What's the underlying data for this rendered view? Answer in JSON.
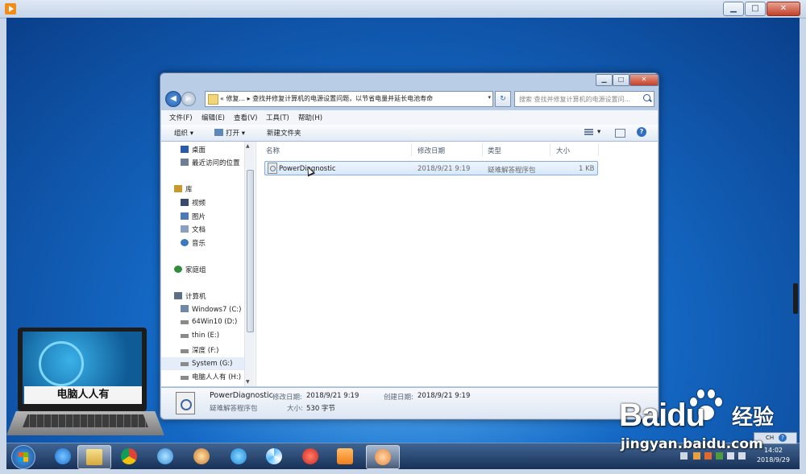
{
  "window": {
    "controls": {
      "minimize": "▁",
      "maximize": "□",
      "close": "✕"
    }
  },
  "explorer": {
    "address": {
      "path": "«  修复...  ▸ 查找并修复计算机的电源设置问题，以节省电量并延长电池寿命",
      "dropdown": "▾"
    },
    "search_placeholder": "搜索 查找并修复计算机的电源设置问...",
    "menu": [
      "文件(F)",
      "编辑(E)",
      "查看(V)",
      "工具(T)",
      "帮助(H)"
    ],
    "toolbar": {
      "organize": "组织 ▾",
      "open": "打开 ▾",
      "new_folder": "新建文件夹",
      "view_menu": "▾",
      "help": "?"
    },
    "nav": [
      {
        "label": "桌面",
        "color": "#2b5aa8"
      },
      {
        "label": "最近访问的位置",
        "color": "#6d7e95"
      },
      {
        "label": "库",
        "color": "#c79a2b"
      },
      {
        "label": "视频",
        "color": "#3b4a6a"
      },
      {
        "label": "图片",
        "color": "#4a7bb8"
      },
      {
        "label": "文档",
        "color": "#8aa0bf"
      },
      {
        "label": "音乐",
        "color": "#3a78c0"
      },
      {
        "label": "家庭组",
        "color": "#2f8e3a"
      },
      {
        "label": "计算机",
        "color": "#5d6f87"
      },
      {
        "label": "Windows7 (C:)",
        "color": "#6f8aa8"
      },
      {
        "label": "64Win10 (D:)",
        "color": "#8a8a8a"
      },
      {
        "label": "thin (E:)",
        "color": "#8a8a8a"
      },
      {
        "label": "深度 (F:)",
        "color": "#8a8a8a"
      },
      {
        "label": "System (G:)",
        "color": "#8a8a8a"
      },
      {
        "label": "电脑人人有 (H:)",
        "color": "#8a8a8a"
      }
    ],
    "columns": {
      "name": "名称",
      "modified": "修改日期",
      "type": "类型",
      "size": "大小"
    },
    "files": [
      {
        "name": "PowerDiagnostic",
        "modified": "2018/9/21 9:19",
        "type": "疑难解答程序包",
        "size": "1 KB"
      }
    ],
    "details": {
      "name": "PowerDiagnostic",
      "type": "疑难解答程序包",
      "modified_label": "修改日期:",
      "modified": "2018/9/21 9:19",
      "created_label": "创建日期:",
      "created": "2018/9/21 9:19",
      "size_label": "大小:",
      "size": "530 字节"
    }
  },
  "laptop_label": "电脑人人有",
  "taskbar": {
    "apps": [
      "explorer",
      "ie",
      "chrome",
      "app-blue",
      "paint",
      "edge",
      "pinwheel",
      "chess",
      "media-player",
      "pet"
    ],
    "clock_time": "14:02",
    "clock_date": "2018/9/29",
    "ime_label": "CH",
    "ime_help": "?"
  },
  "watermark": {
    "logo": "Baidu",
    "cn": "经验",
    "url": "jingyan.baidu.com"
  },
  "colors": {
    "accent": "#3b79c3",
    "selection": "#d7e8fb",
    "close": "#c2412a"
  }
}
